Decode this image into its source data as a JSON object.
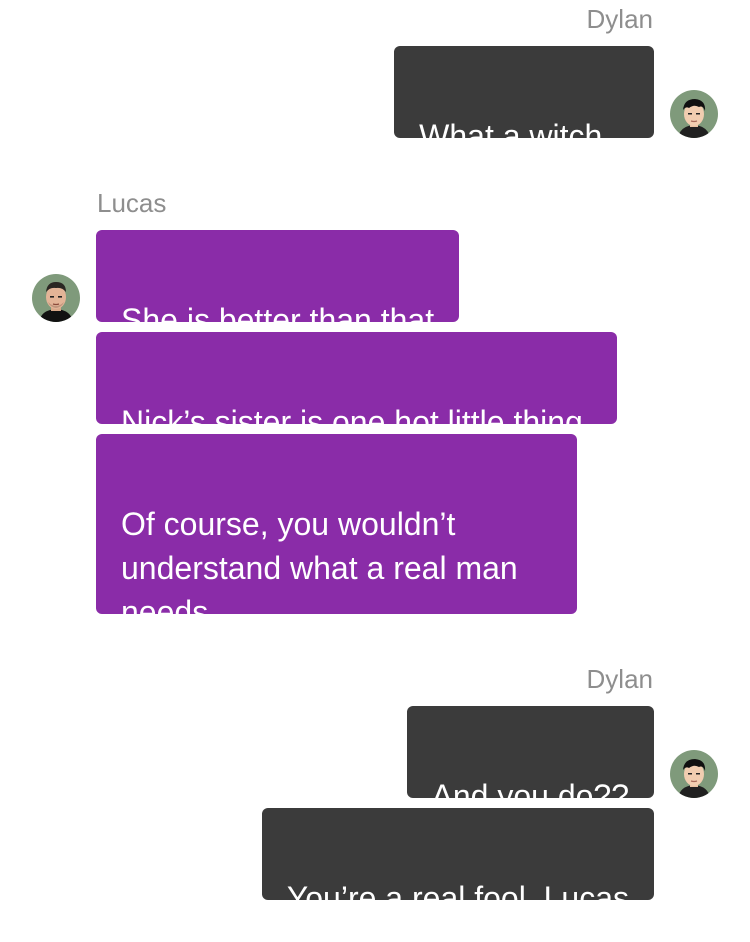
{
  "conversation": {
    "groups": [
      {
        "sender": "Dylan",
        "side": "right",
        "messages": [
          "What a witch..."
        ]
      },
      {
        "sender": "Lucas",
        "side": "left",
        "messages": [
          "She is better than that",
          "Nick’s sister is one hot little thing.",
          "Of course, you wouldn’t\nunderstand what a real man\nneeds"
        ]
      },
      {
        "sender": "Dylan",
        "side": "right",
        "messages": [
          "And you do??",
          "You’re a real fool, Lucas"
        ]
      }
    ]
  },
  "colors": {
    "outgoing_bubble": "#3b3b3b",
    "incoming_bubble": "#8a2ca8",
    "sender_name": "#8e8e8e",
    "avatar_bg": "#7f9a7b"
  }
}
